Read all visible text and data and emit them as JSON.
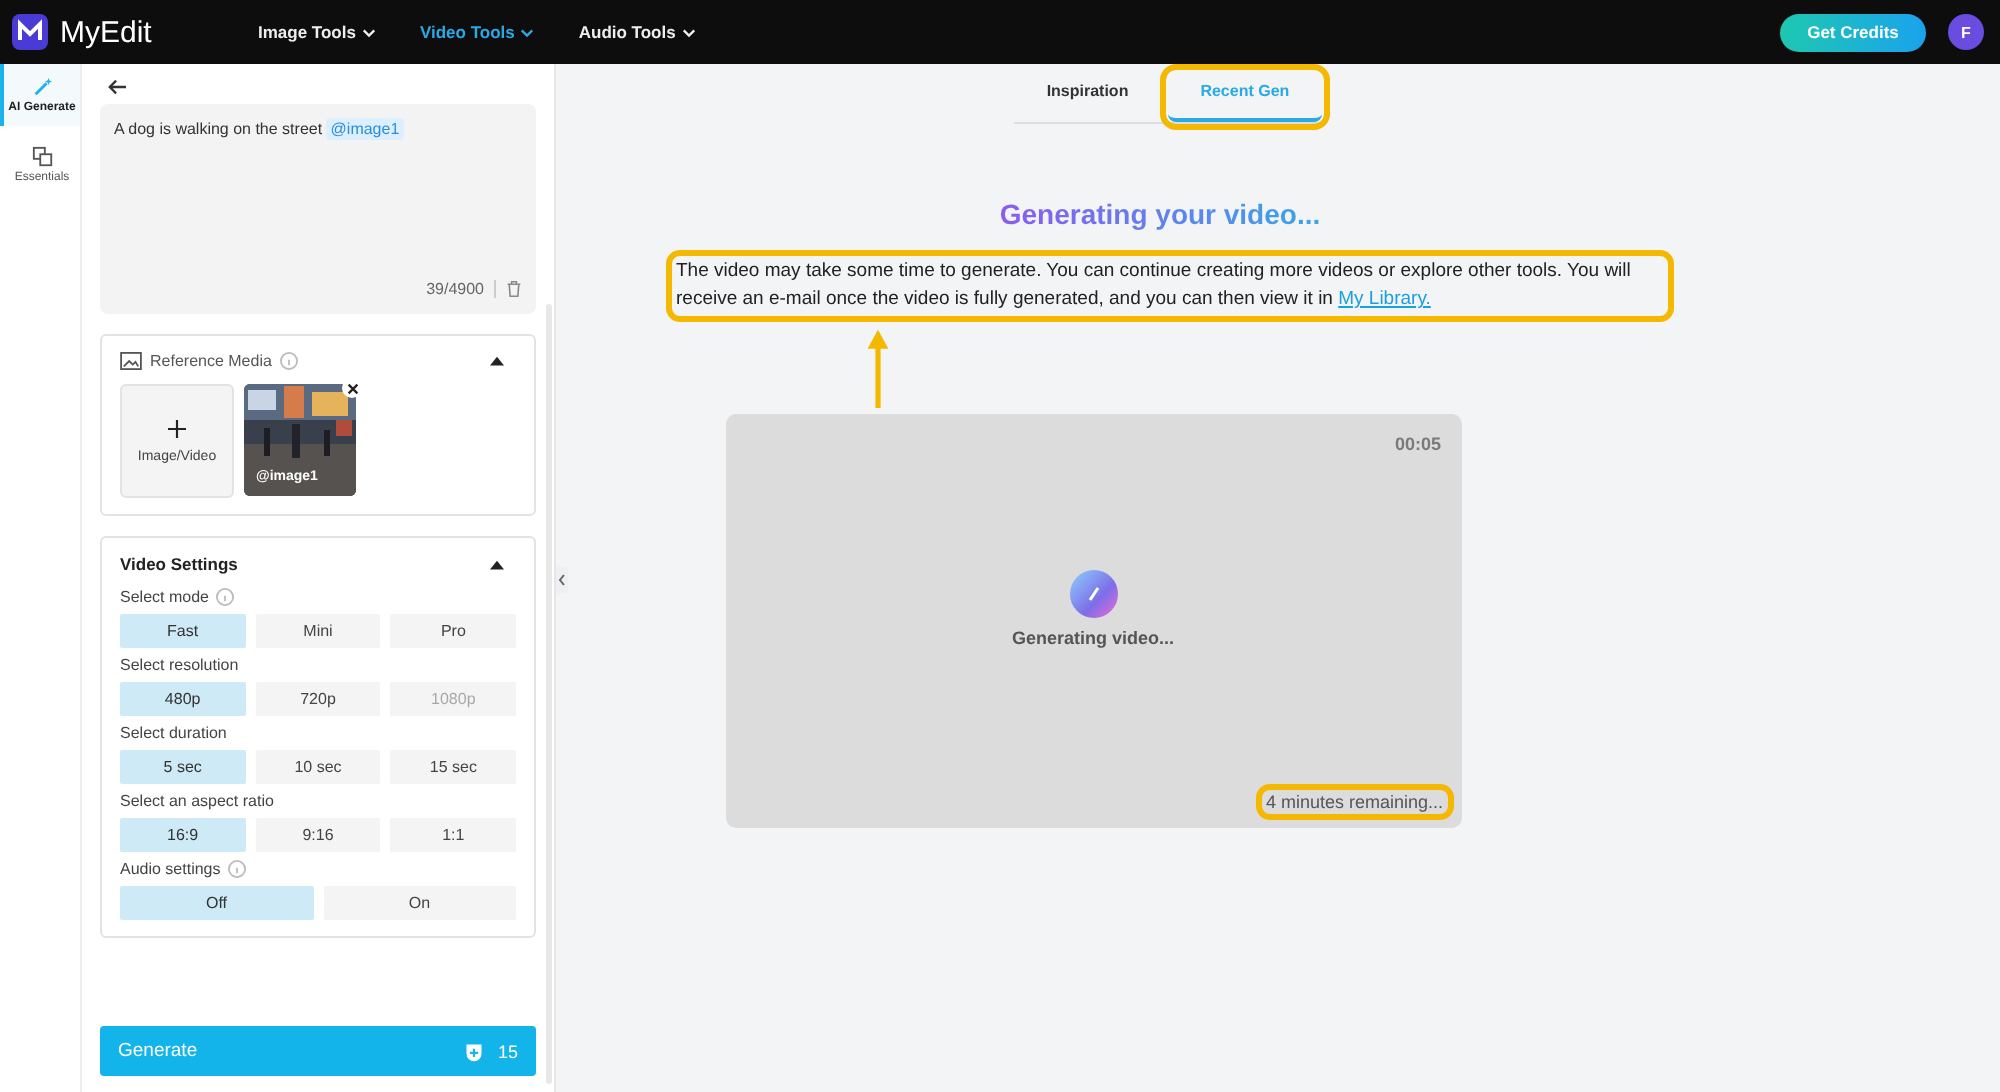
{
  "app": {
    "name": "MyEdit"
  },
  "nav": [
    {
      "label": "Image Tools",
      "selected": false
    },
    {
      "label": "Video Tools",
      "selected": true
    },
    {
      "label": "Audio Tools",
      "selected": false
    }
  ],
  "get_credits": "Get Credits",
  "avatar": "F",
  "rail": [
    {
      "label": "AI Generate",
      "selected": true,
      "kind": "wand"
    },
    {
      "label": "Essentials",
      "selected": false,
      "kind": "layers"
    }
  ],
  "prompt": {
    "value": "A dog is walking on the street",
    "tag": "@image1",
    "count": "39/4900"
  },
  "reference": {
    "title": "Reference Media",
    "add_label": "Image/Video",
    "items": [
      {
        "kind": "picture",
        "tag": "@image1"
      }
    ]
  },
  "settings": {
    "title": "Video Settings",
    "groups": [
      {
        "label": "Select mode",
        "info": true,
        "options": [
          {
            "label": "Fast",
            "selected": true,
            "disabled": false
          },
          {
            "label": "Mini",
            "selected": false,
            "disabled": false
          },
          {
            "label": "Pro",
            "selected": false,
            "disabled": false
          }
        ]
      },
      {
        "label": "Select resolution",
        "info": false,
        "options": [
          {
            "label": "480p",
            "selected": true,
            "disabled": false
          },
          {
            "label": "720p",
            "selected": false,
            "disabled": false
          },
          {
            "label": "1080p",
            "selected": false,
            "disabled": true
          }
        ]
      },
      {
        "label": "Select duration",
        "info": false,
        "options": [
          {
            "label": "5 sec",
            "selected": true,
            "disabled": false
          },
          {
            "label": "10 sec",
            "selected": false,
            "disabled": false
          },
          {
            "label": "15 sec",
            "selected": false,
            "disabled": false
          }
        ]
      },
      {
        "label": "Select an aspect ratio",
        "info": false,
        "options": [
          {
            "label": "16:9",
            "selected": true,
            "disabled": false
          },
          {
            "label": "9:16",
            "selected": false,
            "disabled": false
          },
          {
            "label": "1:1",
            "selected": false,
            "disabled": false
          }
        ]
      },
      {
        "label": "Audio settings",
        "info": true,
        "options": [
          {
            "label": "Off",
            "selected": true,
            "disabled": false
          },
          {
            "label": "On",
            "selected": false,
            "disabled": false
          }
        ]
      }
    ]
  },
  "generate": {
    "label": "Generate",
    "cost": "15"
  },
  "tabs": [
    {
      "label": "Inspiration",
      "selected": false,
      "highlighted": false
    },
    {
      "label": "Recent Gen",
      "selected": true,
      "highlighted": true
    }
  ],
  "status": {
    "title": "Generating your video...",
    "message": "The video may take some time to generate. You can continue creating more videos or explore other tools. You will receive an e-mail once the video is fully generated, and you can then view it in ",
    "link": "My Library.",
    "highlighted": true
  },
  "preview": {
    "duration": "00:05",
    "label": "Generating video...",
    "remaining": "4 minutes remaining...",
    "remaining_highlighted": true
  }
}
